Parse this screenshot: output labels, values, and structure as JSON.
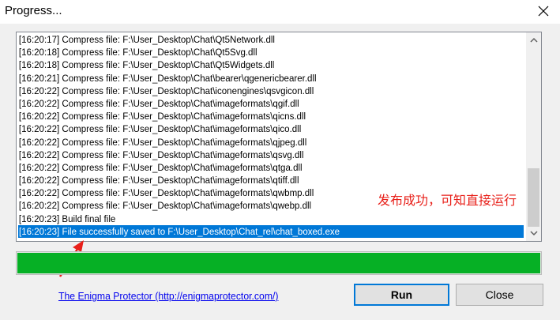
{
  "window": {
    "title": "Progress...",
    "close_icon": "close-icon"
  },
  "log": {
    "lines": [
      "[16:20:17] Compress file: F:\\User_Desktop\\Chat\\Qt5Network.dll",
      "[16:20:18] Compress file: F:\\User_Desktop\\Chat\\Qt5Svg.dll",
      "[16:20:18] Compress file: F:\\User_Desktop\\Chat\\Qt5Widgets.dll",
      "[16:20:21] Compress file: F:\\User_Desktop\\Chat\\bearer\\qgenericbearer.dll",
      "[16:20:22] Compress file: F:\\User_Desktop\\Chat\\iconengines\\qsvgicon.dll",
      "[16:20:22] Compress file: F:\\User_Desktop\\Chat\\imageformats\\qgif.dll",
      "[16:20:22] Compress file: F:\\User_Desktop\\Chat\\imageformats\\qicns.dll",
      "[16:20:22] Compress file: F:\\User_Desktop\\Chat\\imageformats\\qico.dll",
      "[16:20:22] Compress file: F:\\User_Desktop\\Chat\\imageformats\\qjpeg.dll",
      "[16:20:22] Compress file: F:\\User_Desktop\\Chat\\imageformats\\qsvg.dll",
      "[16:20:22] Compress file: F:\\User_Desktop\\Chat\\imageformats\\qtga.dll",
      "[16:20:22] Compress file: F:\\User_Desktop\\Chat\\imageformats\\qtiff.dll",
      "[16:20:22] Compress file: F:\\User_Desktop\\Chat\\imageformats\\qwbmp.dll",
      "[16:20:22] Compress file: F:\\User_Desktop\\Chat\\imageformats\\qwebp.dll",
      "[16:20:23] Build final file"
    ],
    "selected_line": "[16:20:23] File successfully saved to F:\\User_Desktop\\Chat_rel\\chat_boxed.exe",
    "selection_color": "#0078d7"
  },
  "annotation": {
    "text": "发布成功，可知直接运行",
    "color": "#e8201a"
  },
  "progress": {
    "value": 1.0,
    "color": "#06b025"
  },
  "footer": {
    "link_text": "The Enigma Protector (http://enigmaprotector.com/)",
    "run_label": "Run",
    "close_label": "Close"
  }
}
